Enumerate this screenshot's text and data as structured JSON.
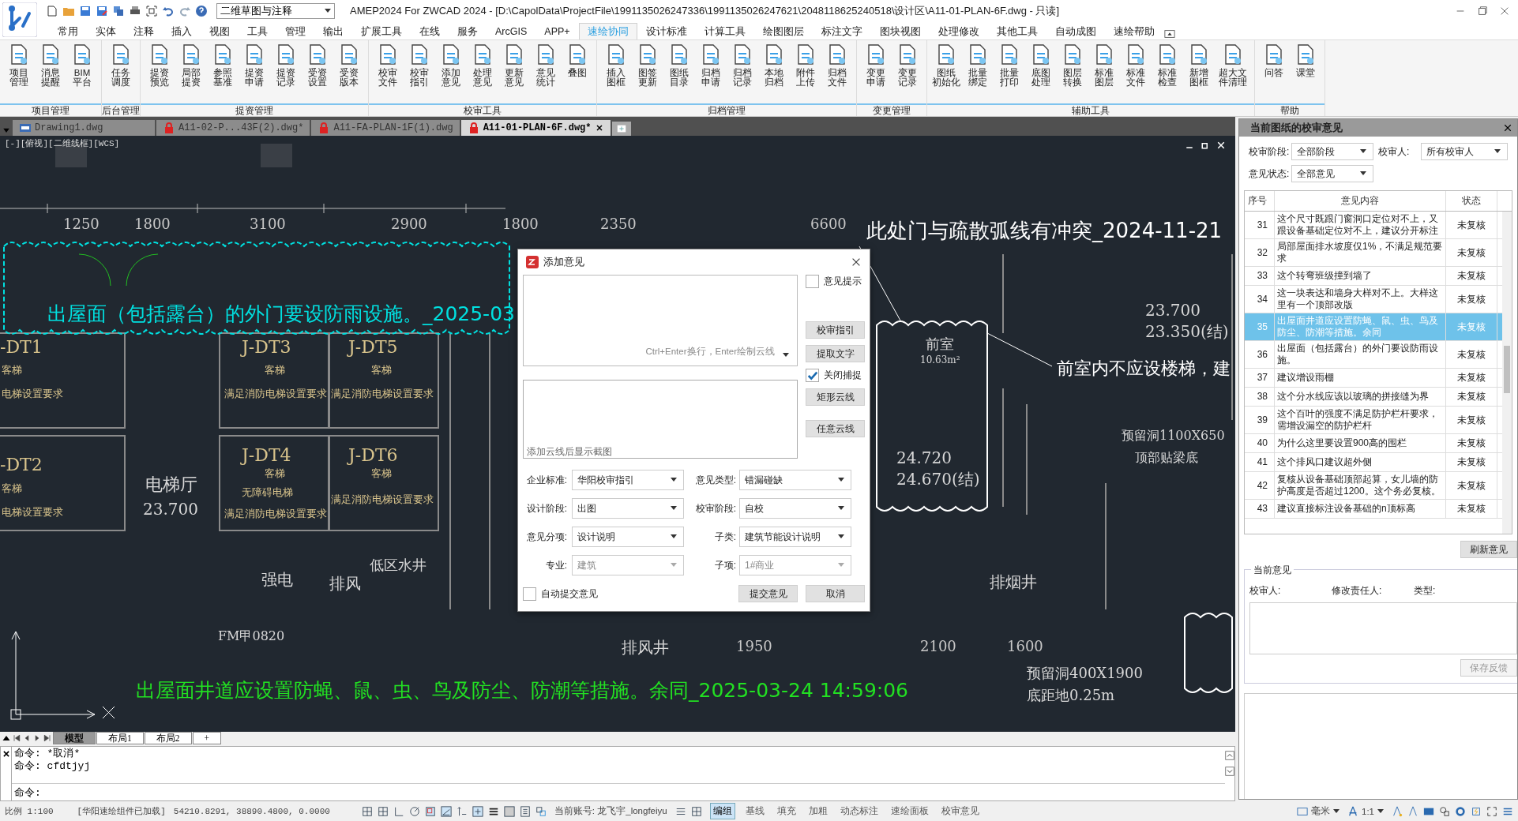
{
  "window": {
    "title": "AMEP2024 For ZWCAD 2024 - [D:\\CapolData\\ProjectFile\\1991135026247336\\1991135026247621\\2048118625240518\\设计区\\A11-01-PLAN-6F.dwg - 只读]",
    "workspace": "二维草图与注释"
  },
  "menu_tabs": [
    {
      "label": "常用",
      "selected": false
    },
    {
      "label": "实体",
      "selected": false
    },
    {
      "label": "注释",
      "selected": false
    },
    {
      "label": "插入",
      "selected": false
    },
    {
      "label": "视图",
      "selected": false
    },
    {
      "label": "工具",
      "selected": false
    },
    {
      "label": "管理",
      "selected": false
    },
    {
      "label": "输出",
      "selected": false
    },
    {
      "label": "扩展工具",
      "selected": false
    },
    {
      "label": "在线",
      "selected": false
    },
    {
      "label": "服务",
      "selected": false
    },
    {
      "label": "ArcGIS",
      "selected": false
    },
    {
      "label": "APP+",
      "selected": false
    },
    {
      "label": "速绘协同",
      "selected": true
    },
    {
      "label": "设计标准",
      "selected": false
    },
    {
      "label": "计算工具",
      "selected": false
    },
    {
      "label": "绘图图层",
      "selected": false
    },
    {
      "label": "标注文字",
      "selected": false
    },
    {
      "label": "图块视图",
      "selected": false
    },
    {
      "label": "处理修改",
      "selected": false
    },
    {
      "label": "其他工具",
      "selected": false
    },
    {
      "label": "自动成图",
      "selected": false
    },
    {
      "label": "速绘帮助",
      "selected": false
    }
  ],
  "ribbon_groups": [
    {
      "title": "项目管理",
      "buttons": [
        "项目管理",
        "消息提醒",
        "BIM平台"
      ]
    },
    {
      "title": "后台管理",
      "buttons": [
        "任务调度"
      ]
    },
    {
      "title": "提资管理",
      "buttons": [
        "提资预览",
        "局部提资",
        "参照基准",
        "提资申请",
        "提资记录",
        "受资设置",
        "受资版本"
      ]
    },
    {
      "title": "校审工具",
      "buttons": [
        "校审文件",
        "校审指引",
        "添加意见",
        "处理意见",
        "更新意见",
        "意见统计",
        "叠图"
      ]
    },
    {
      "title": "归档管理",
      "buttons": [
        "插入图框",
        "图签更新",
        "图纸目录",
        "归档申请",
        "归档记录",
        "本地归档",
        "附件上传",
        "归档文件"
      ]
    },
    {
      "title": "变更管理",
      "buttons": [
        "变更申请",
        "变更记录"
      ]
    },
    {
      "title": "辅助工具",
      "buttons": [
        "图纸初始化",
        "批量绑定",
        "批量打印",
        "底图处理",
        "图层转换",
        "标准图层",
        "标准文件",
        "标准检查",
        "新增图框",
        "超大文件清理"
      ]
    },
    {
      "title": "帮助",
      "buttons": [
        "问答",
        "课堂"
      ]
    }
  ],
  "doc_tabs": [
    {
      "label": "Drawing1.dwg",
      "kind": "plain",
      "selected": false
    },
    {
      "label": "A11-02-P...43F(2).dwg*",
      "kind": "locked",
      "selected": false
    },
    {
      "label": "A11-FA-PLAN-1F(1).dwg",
      "kind": "locked",
      "selected": false
    },
    {
      "label": "A11-01-PLAN-6F.dwg*",
      "kind": "locked",
      "selected": true
    }
  ],
  "canvas": {
    "viewport_label": "[-][俯视][二维线框][WCS]",
    "labels": [
      {
        "text": "1250",
        "kind": "dimension"
      },
      {
        "text": "1800",
        "kind": "dimension"
      },
      {
        "text": "3100",
        "kind": "dimension"
      },
      {
        "text": "2900",
        "kind": "dimension"
      },
      {
        "text": "1800",
        "kind": "dimension"
      },
      {
        "text": "2350",
        "kind": "dimension"
      },
      {
        "text": "6600",
        "kind": "dimension"
      },
      {
        "text": "此处门与疏散弧线有冲突_2024-11-21",
        "kind": "comment",
        "color": "#ffffff"
      },
      {
        "text": "出屋面（包括露台）的外门要设防雨设施。_2025-03",
        "kind": "comment",
        "color": "#00e0e0"
      },
      {
        "text": "前室内不应设楼梯，建",
        "kind": "comment",
        "color": "#ffffff"
      },
      {
        "text": "出屋面井道应设置防蝇、鼠、虫、鸟及防尘、防潮等措施。余同_2025-03-24 14:59:06",
        "kind": "comment",
        "color": "#22e022"
      },
      {
        "text": "-DT1",
        "kind": "tag"
      },
      {
        "text": "J-DT3",
        "kind": "tag"
      },
      {
        "text": "J-DT5",
        "kind": "tag"
      },
      {
        "text": "-DT2",
        "kind": "tag"
      },
      {
        "text": "J-DT4",
        "kind": "tag"
      },
      {
        "text": "J-DT6",
        "kind": "tag"
      },
      {
        "text": "客梯",
        "kind": "note"
      },
      {
        "text": "电梯设置要求",
        "kind": "note"
      },
      {
        "text": "客梯",
        "kind": "note"
      },
      {
        "text": "电梯设置要求",
        "kind": "note"
      },
      {
        "text": "客梯",
        "kind": "note"
      },
      {
        "text": "满足消防电梯设置要求",
        "kind": "note"
      },
      {
        "text": "客梯",
        "kind": "note"
      },
      {
        "text": "满足消防电梯设置要求",
        "kind": "note"
      },
      {
        "text": "客梯",
        "kind": "note"
      },
      {
        "text": "无障碍电梯",
        "kind": "note"
      },
      {
        "text": "满足消防电梯设置要求",
        "kind": "note"
      },
      {
        "text": "客梯",
        "kind": "note"
      },
      {
        "text": "满足消防电梯设置要求",
        "kind": "note"
      },
      {
        "text": "23.700",
        "kind": "room"
      },
      {
        "text": "23.350(结)",
        "kind": "room"
      },
      {
        "text": "前室",
        "kind": "room"
      },
      {
        "text": "10.63m²",
        "kind": "room"
      },
      {
        "text": "预留洞1100X650",
        "kind": "room"
      },
      {
        "text": "24.720",
        "kind": "room"
      },
      {
        "text": "顶部贴梁底",
        "kind": "room"
      },
      {
        "text": "电梯厅",
        "kind": "room"
      },
      {
        "text": "24.670(结)",
        "kind": "room"
      },
      {
        "text": "23.700",
        "kind": "room"
      },
      {
        "text": "低区水井",
        "kind": "room"
      },
      {
        "text": "强电",
        "kind": "room"
      },
      {
        "text": "排风",
        "kind": "room"
      },
      {
        "text": "排烟井",
        "kind": "room"
      },
      {
        "text": "FM甲0820",
        "kind": "room"
      },
      {
        "text": "排风井",
        "kind": "room"
      },
      {
        "text": "1950",
        "kind": "dimension"
      },
      {
        "text": "2100",
        "kind": "dimension"
      },
      {
        "text": "1600",
        "kind": "dimension"
      },
      {
        "text": "预留洞400X1900",
        "kind": "room"
      },
      {
        "text": "底距地0.25m",
        "kind": "room"
      }
    ]
  },
  "dialog": {
    "title": "添加意见",
    "comment_placeholder": "Ctrl+Enter换行，Enter绘制云线",
    "screenshot_caption": "添加云线后显示截图",
    "checks": [
      {
        "label": "意见提示",
        "checked": false
      },
      {
        "label": "关闭捕捉",
        "checked": true
      }
    ],
    "side_buttons": [
      "校审指引",
      "提取文字",
      "矩形云线",
      "任意云线"
    ],
    "fields": [
      {
        "label": "企业标准:",
        "value": "华阳校审指引",
        "disabled": false
      },
      {
        "label": "意见类型:",
        "value": "错漏碰缺",
        "disabled": false
      },
      {
        "label": "设计阶段:",
        "value": "出图",
        "disabled": false
      },
      {
        "label": "校审阶段:",
        "value": "自校",
        "disabled": false
      },
      {
        "label": "意见分项:",
        "value": "设计说明",
        "disabled": false
      },
      {
        "label": "子类:",
        "value": "建筑节能设计说明",
        "disabled": false
      },
      {
        "label": "专业:",
        "value": "建筑",
        "disabled": true
      },
      {
        "label": "子项:",
        "value": "1#商业",
        "disabled": true
      }
    ],
    "auto_submit": {
      "label": "自动提交意见",
      "checked": false
    },
    "buttons": [
      "提交意见",
      "取消"
    ]
  },
  "layout_tabs": [
    {
      "label": "模型",
      "selected": true
    },
    {
      "label": "布局1",
      "selected": false
    },
    {
      "label": "布局2",
      "selected": false
    },
    {
      "label": "+",
      "selected": false
    }
  ],
  "command": {
    "history": [
      "命令: *取消*",
      "命令: cfdtjyj"
    ],
    "prompt": "命令:"
  },
  "panel": {
    "title": "当前图纸的校审意见",
    "filters": [
      {
        "label": "校审阶段:",
        "value": "全部阶段"
      },
      {
        "label": "校审人:",
        "value": "所有校审人"
      },
      {
        "label": "意见状态:",
        "value": "全部意见"
      }
    ],
    "columns": [
      "序号",
      "意见内容",
      "状态"
    ],
    "rows": [
      {
        "no": "31",
        "content": "这个尺寸既跟门窗洞口定位对不上，又跟设备基础定位对不上，建议分开标注",
        "status": "未复核",
        "selected": false
      },
      {
        "no": "32",
        "content": "局部屋面排水坡度仅1%，不满足规范要求",
        "status": "未复核",
        "selected": false
      },
      {
        "no": "33",
        "content": "这个转弯班级撞到墙了",
        "status": "未复核",
        "selected": false
      },
      {
        "no": "34",
        "content": "这一块表达和墙身大样对不上。大样这里有一个顶部改版",
        "status": "未复核",
        "selected": false
      },
      {
        "no": "35",
        "content": "出屋面井道应设置防蝇、鼠、虫、鸟及防尘、防潮等措施。余同",
        "status": "未复核",
        "selected": true
      },
      {
        "no": "36",
        "content": "出屋面（包括露台）的外门要设防雨设施。",
        "status": "未复核",
        "selected": false
      },
      {
        "no": "37",
        "content": "建议增设雨棚",
        "status": "未复核",
        "selected": false
      },
      {
        "no": "38",
        "content": "这个分水线应该以玻璃的拼接缝为界",
        "status": "未复核",
        "selected": false
      },
      {
        "no": "39",
        "content": "这个百叶的强度不满足防护栏杆要求，需增设漏空的防护栏杆",
        "status": "未复核",
        "selected": false
      },
      {
        "no": "40",
        "content": "为什么这里要设置900高的围栏",
        "status": "未复核",
        "selected": false
      },
      {
        "no": "41",
        "content": "这个排风口建议超外侧",
        "status": "未复核",
        "selected": false
      },
      {
        "no": "42",
        "content": "复核从设备基础顶部起算，女儿墙的防护高度是否超过1200。这个务必复核。",
        "status": "未复核",
        "selected": false
      },
      {
        "no": "43",
        "content": "建议直接标注设备基础的n顶标高",
        "status": "未复核",
        "selected": false
      }
    ],
    "refresh_button": "刷新意见",
    "current": {
      "title": "当前意见",
      "fields": [
        "校审人:",
        "修改责任人:",
        "类型:"
      ],
      "save_button": "保存反馈",
      "save_disabled": true
    }
  },
  "status_bar": {
    "scale": "比例 1:100",
    "plugin": "[华阳速绘组件已加载]",
    "coords": "54210.8291, 38890.4800, 0.0000",
    "account": "当前账号: 龙飞宇_longfeiyu",
    "toggles": [
      {
        "label": "编组",
        "on": true
      },
      {
        "label": "基线",
        "on": false
      },
      {
        "label": "填充",
        "on": false
      },
      {
        "label": "加粗",
        "on": false
      },
      {
        "label": "动态标注",
        "on": false
      },
      {
        "label": "速绘面板",
        "on": false
      },
      {
        "label": "校审意见",
        "on": false
      }
    ],
    "unit": "毫米",
    "annotation_scale": "1:1"
  }
}
